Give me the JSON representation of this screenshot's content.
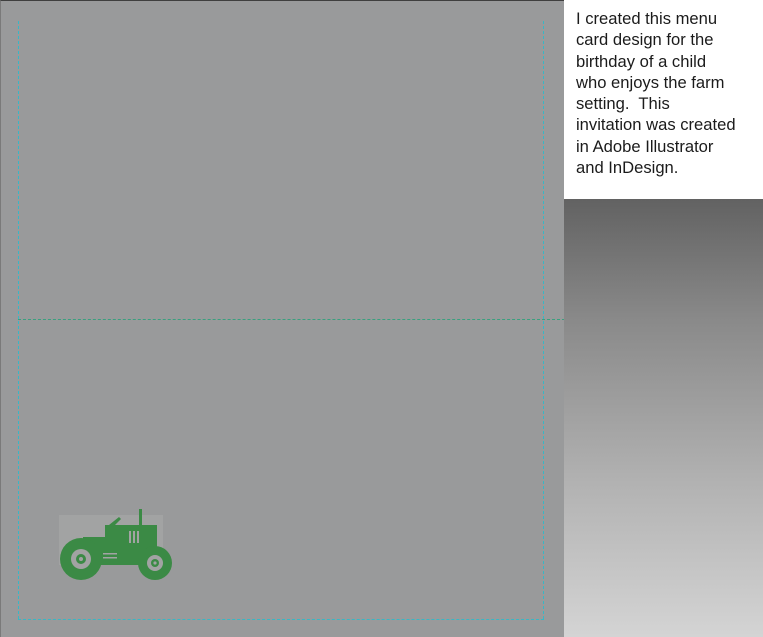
{
  "caption": {
    "text": "I created this menu\ncard design for the\nbirthday of a child\nwho enjoys the farm\nsetting.  This\ninvitation was created\nin Adobe Illustrator\nand InDesign."
  },
  "colors": {
    "canvas": "#999a9b",
    "guide": "#39b7c4",
    "fold_line": "#3aa07f",
    "tractor": "#3b8a45"
  },
  "icons": {
    "tractor": "tractor-icon"
  }
}
